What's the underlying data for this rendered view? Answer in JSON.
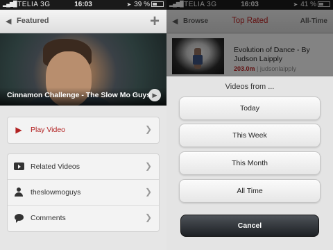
{
  "status_left": {
    "carrier": "TELIA",
    "network": "3G",
    "time": "16:03",
    "battery": "39 %"
  },
  "status_right": {
    "carrier": "TELIA",
    "network": "3G",
    "time": "16:03",
    "battery": "41 %"
  },
  "left_nav": {
    "back_label": "Featured"
  },
  "hero": {
    "caption": "Cinnamon Challenge - The Slow Mo Guys"
  },
  "actions": [
    {
      "label": "Play Video",
      "icon": "play-icon",
      "color": "#b22222"
    }
  ],
  "links": [
    {
      "label": "Related Videos",
      "icon": "video-icon"
    },
    {
      "label": "theslowmoguys",
      "icon": "user-icon"
    },
    {
      "label": "Comments",
      "icon": "comment-icon"
    }
  ],
  "right_nav": {
    "back_label": "Browse",
    "title": "Top Rated",
    "right_label": "All-Time"
  },
  "top_video": {
    "title": "Evolution of Dance - By Judson Laipply",
    "views": "203.0m",
    "separator": "|",
    "user": "judsonlaipply"
  },
  "sheet": {
    "heading": "Videos from ...",
    "options": [
      "Today",
      "This Week",
      "This Month",
      "All Time"
    ],
    "cancel": "Cancel"
  },
  "colors": {
    "accent": "#b22222",
    "cancel_bg": "#2a2e33"
  }
}
